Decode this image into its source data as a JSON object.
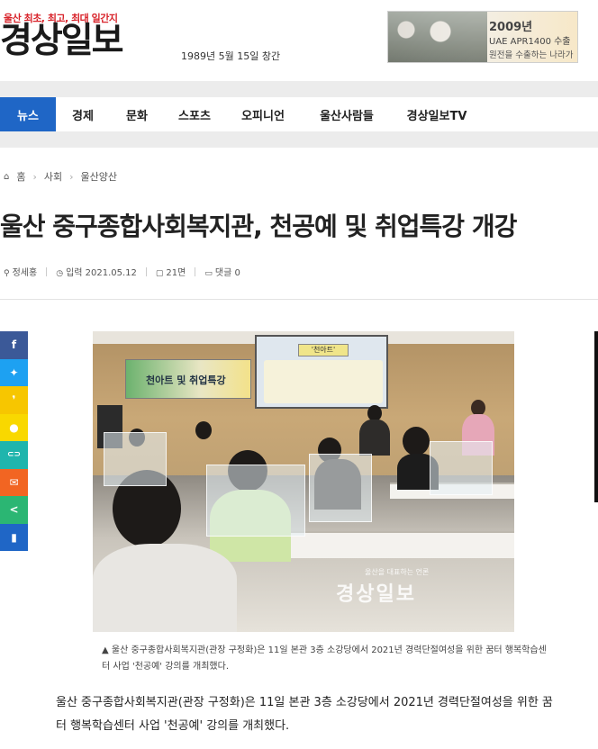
{
  "header": {
    "tagline": "울산 최초, 최고, 최대 일간지",
    "logo": "경상일보",
    "founded": "1989년 5월 15일 창간",
    "ad": {
      "line1": "2009년",
      "line2": "UAE APR1400 수출",
      "line3": "원전을 수출하는 나라가 됐다!"
    }
  },
  "nav": {
    "items": [
      {
        "label": "뉴스",
        "active": true
      },
      {
        "label": "경제"
      },
      {
        "label": "문화"
      },
      {
        "label": "스포츠"
      },
      {
        "label": "오피니언"
      },
      {
        "label": "울산사람들"
      },
      {
        "label": "경상일보TV"
      }
    ]
  },
  "breadcrumb": {
    "home": "홈",
    "section": "사회",
    "subsection": "울산양산"
  },
  "article": {
    "title": "울산 중구종합사회복지관, 천공예 및 취업특강 개강",
    "author": "정세홍",
    "date": "입력 2021.05.12",
    "page": "21면",
    "comments": "댓글 0",
    "photo": {
      "banner": "천아트 및 취업특강",
      "screen": "'천아트'",
      "watermark_sub": "울산을 대표하는 언론",
      "watermark": "경상일보"
    },
    "caption": "▲ 울산 중구종합사회복지관(관장 구정화)은 11일 본관 3층 소강당에서 2021년 경력단절여성을 위한 꿈터 행복학습센터 사업 '천공예' 강의를 개최했다.",
    "body": "울산 중구종합사회복지관(관장 구정화)은 11일 본관 3층 소강당에서 2021년 경력단절여성을 위한 꿈터 행복학습센터 사업 '천공예' 강의를 개최했다."
  },
  "share": [
    {
      "name": "facebook-icon",
      "glyph": "f",
      "color": "#3b5998"
    },
    {
      "name": "twitter-icon",
      "glyph": "✦",
      "color": "#1da1f2"
    },
    {
      "name": "kakaostory-icon",
      "glyph": "❜",
      "color": "#f7c600"
    },
    {
      "name": "kakaotalk-icon",
      "glyph": "●",
      "color": "#f9d800"
    },
    {
      "name": "link-icon",
      "glyph": "⊂⊃",
      "color": "#1fb5ad"
    },
    {
      "name": "email-icon",
      "glyph": "✉",
      "color": "#f26522"
    },
    {
      "name": "share-icon",
      "glyph": "<",
      "color": "#2bb673"
    },
    {
      "name": "bookmark-icon",
      "glyph": "▮",
      "color": "#1f66c6"
    }
  ]
}
